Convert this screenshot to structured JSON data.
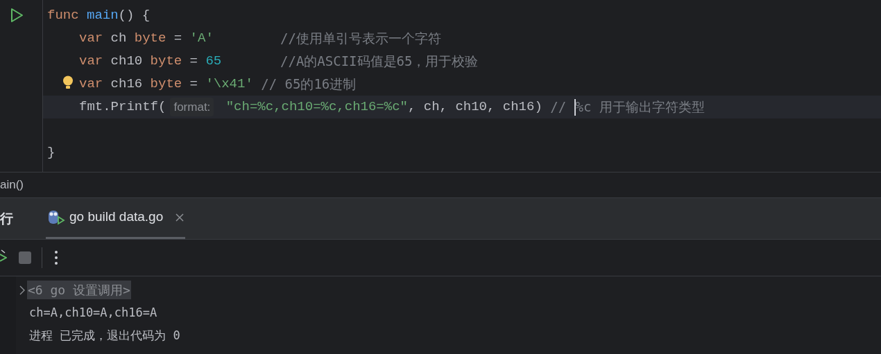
{
  "editor": {
    "lines": [
      {
        "current": false,
        "indent": false,
        "tokens": [
          {
            "kind": "keyword",
            "text": "func"
          },
          {
            "kind": "function",
            "text": "main"
          },
          {
            "kind": "plain",
            "text": "() {"
          }
        ]
      },
      {
        "current": false,
        "indent": true,
        "tokens": [
          {
            "kind": "keyword",
            "text": "var"
          },
          {
            "kind": "plain",
            "text": "ch"
          },
          {
            "kind": "keyword",
            "text": "byte"
          },
          {
            "kind": "plain",
            "text": "="
          },
          {
            "kind": "string",
            "text": "'A'"
          }
        ],
        "comment": {
          "text": "//使用单引号表示一个字符",
          "aligned": true
        }
      },
      {
        "current": false,
        "indent": true,
        "tokens": [
          {
            "kind": "keyword",
            "text": "var"
          },
          {
            "kind": "plain",
            "text": "ch10"
          },
          {
            "kind": "keyword",
            "text": "byte"
          },
          {
            "kind": "plain",
            "text": "="
          },
          {
            "kind": "number",
            "text": "65"
          }
        ],
        "comment": {
          "text": "//A的ASCII码值是65，用于校验",
          "aligned": true
        }
      },
      {
        "current": false,
        "indent": true,
        "bulb": true,
        "tokens": [
          {
            "kind": "keyword",
            "text": "var"
          },
          {
            "kind": "plain",
            "text": "ch16"
          },
          {
            "kind": "keyword",
            "text": "byte"
          },
          {
            "kind": "plain",
            "text": "="
          },
          {
            "kind": "string",
            "text": "'\\x41'"
          }
        ],
        "comment": {
          "text": "// 65的16进制",
          "aligned": false
        }
      },
      {
        "current": true,
        "indent": true,
        "tokens": [
          {
            "kind": "function_call",
            "text": "fmt.Printf("
          },
          {
            "kind": "hint",
            "text": "format:"
          },
          {
            "kind": "string",
            "text": "\"ch=%c,ch10=%c,ch16=%c\""
          },
          {
            "kind": "plain",
            "text": ", ch, ch10, ch16)"
          }
        ],
        "comment": {
          "text": "// ",
          "aligned": false
        },
        "comment_after_caret": "%c 用于输出字符类型"
      },
      {
        "current": false
      },
      {
        "current": false,
        "indent": false,
        "tokens": [
          {
            "kind": "plain",
            "text": "}"
          }
        ]
      }
    ],
    "breadcrumb": "ain()"
  },
  "run_panel": {
    "title": "行",
    "tabs": [
      {
        "label": "go build data.go",
        "selected": true
      }
    ]
  },
  "console": {
    "lines": [
      {
        "kind": "folded",
        "text": "<6 go 设置调用>"
      },
      {
        "kind": "output",
        "text": "ch=A,ch10=A,ch16=A"
      },
      {
        "kind": "output",
        "text": "进程 已完成，退出代码为 0"
      }
    ]
  }
}
